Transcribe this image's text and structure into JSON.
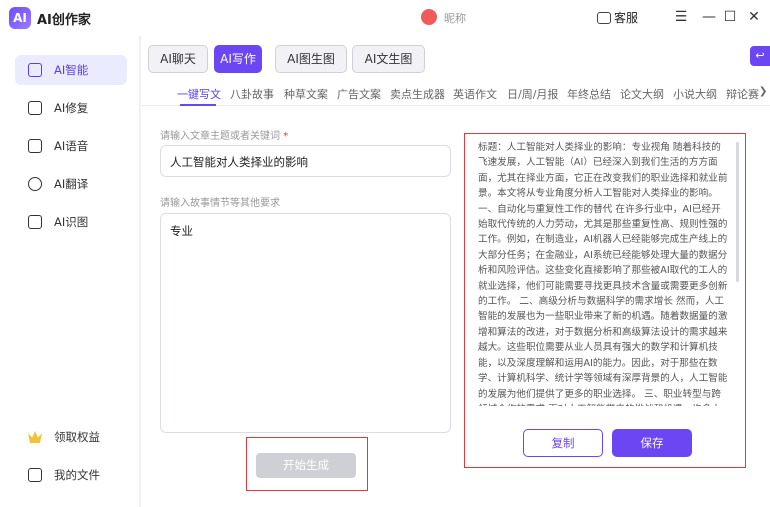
{
  "app": {
    "title": "AI创作家",
    "logo_text": "AI",
    "user_name": "昵称",
    "service_label": "客服"
  },
  "window_controls": {
    "menu": "☰",
    "minimize": "—",
    "maximize": "☐",
    "close": "✕"
  },
  "sidebar": {
    "items": [
      {
        "label": "AI智能",
        "icon": "ai-chip-icon",
        "active": true
      },
      {
        "label": "AI修复",
        "icon": "repair-icon"
      },
      {
        "label": "AI语音",
        "icon": "voice-icon"
      },
      {
        "label": "AI翻译",
        "icon": "translate-icon"
      },
      {
        "label": "AI识图",
        "icon": "image-recognition-icon"
      }
    ],
    "bottom": [
      {
        "label": "领取权益",
        "icon": "crown-icon"
      },
      {
        "label": "我的文件",
        "icon": "file-icon"
      }
    ]
  },
  "top_tabs": [
    "AI聊天",
    "AI写作",
    "AI图生图",
    "AI文生图"
  ],
  "active_top_tab": "AI写作",
  "corner_icon": "back-icon",
  "categories": [
    "一键写文",
    "八卦故事",
    "种草文案",
    "广告文案",
    "卖点生成器",
    "英语作文",
    "日/周/月报",
    "年终总结",
    "论文大纲",
    "小说大纲",
    "辩论赛"
  ],
  "active_category": "一键写文",
  "form": {
    "topic_label": "请输入文章主题或者关键词",
    "topic_required_mark": "*",
    "topic_value": "人工智能对人类择业的影响",
    "story_label": "请输入故事情节等其他要求",
    "story_value": "专业",
    "generate_label": "开始生成"
  },
  "result": {
    "text": "标题：人工智能对人类择业的影响：专业视角 随着科技的飞速发展，人工智能（AI）已经深入到我们生活的方方面面，尤其在择业方面，它正在改变我们的职业选择和就业前景。本文将从专业角度分析人工智能对人类择业的影响。 一、自动化与重复性工作的替代 在许多行业中，AI已经开始取代传统的人力劳动，尤其是那些重复性高、规则性强的工作。例如，在制造业，AI机器人已经能够完成生产线上的大部分任务；在金融业，AI系统已经能够处理大量的数据分析和风险评估。这些变化直接影响了那些被AI取代的工人的就业选择，他们可能需要寻找更具技术含量或需要更多创新的工作。 二、高级分析与数据科学的需求增长 然而，人工智能的发展也为一些职业带来了新的机遇。随着数据量的激增和算法的改进，对于数据分析和高级算法设计的需求越来越大。这些职位需要从业人员具有强大的数学和计算机技能，以及深度理解和运用AI的能力。因此，对于那些在数学、计算机科学、统计学等领域有深厚背景的人，人工智能的发展为他们提供了更多的职业选择。 三、职业转型与跨领域合作的需求 面对人工智能带来的挑战和机遇，许多人在职业选择上做出了转型，他们从传统的、重复性强的岗位",
    "copy_label": "复制",
    "save_label": "保存"
  }
}
